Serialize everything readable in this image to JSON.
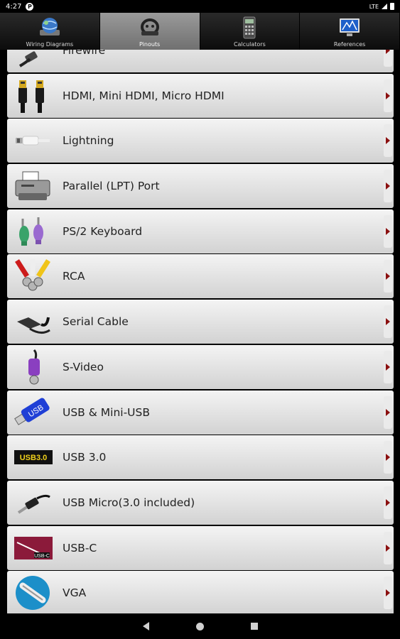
{
  "status": {
    "time": "4:27",
    "notification": "P",
    "network": "LTE"
  },
  "tabs": [
    {
      "label": "Wiring Diagrams",
      "icon": "globe-network-icon",
      "active": false
    },
    {
      "label": "Pinouts",
      "icon": "pinout-connector-icon",
      "active": true
    },
    {
      "label": "Calculators",
      "icon": "calculator-icon",
      "active": false
    },
    {
      "label": "References",
      "icon": "monitor-reference-icon",
      "active": false
    }
  ],
  "items": [
    {
      "label": "Firewire",
      "icon": "firewire-cable-icon"
    },
    {
      "label": "HDMI, Mini HDMI, Micro HDMI",
      "icon": "hdmi-cable-icon"
    },
    {
      "label": "Lightning",
      "icon": "lightning-cable-icon"
    },
    {
      "label": "Parallel (LPT) Port",
      "icon": "printer-icon"
    },
    {
      "label": "PS/2 Keyboard",
      "icon": "ps2-plug-icon"
    },
    {
      "label": "RCA",
      "icon": "rca-plugs-icon"
    },
    {
      "label": "Serial Cable",
      "icon": "serial-cable-icon"
    },
    {
      "label": "S-Video",
      "icon": "svideo-plug-icon"
    },
    {
      "label": "USB & Mini-USB",
      "icon": "usb-stick-icon"
    },
    {
      "label": "USB 3.0",
      "icon": "usb3-logo-icon"
    },
    {
      "label": "USB Micro(3.0 included)",
      "icon": "usb-micro-cable-icon"
    },
    {
      "label": "USB-C",
      "icon": "usbc-badge-icon"
    },
    {
      "label": "VGA",
      "icon": "vga-icon"
    }
  ],
  "usb3_text": "USB3.0",
  "usbc_text": "USB-C",
  "usb_stick_text": "USB"
}
